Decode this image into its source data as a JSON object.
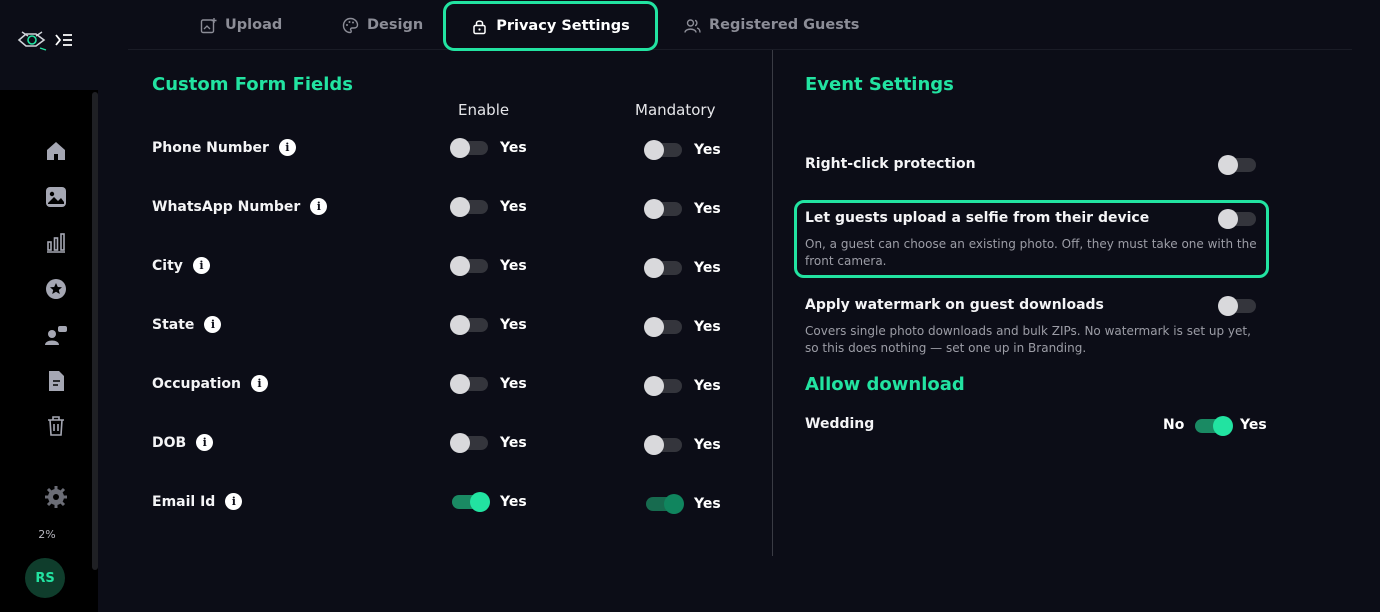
{
  "sidebar": {
    "storage": "2%",
    "avatar": "RS",
    "icons": [
      "home-icon",
      "gallery-icon",
      "analytics-icon",
      "star-icon",
      "users-icon",
      "document-icon",
      "trash-icon",
      "settings-icon"
    ]
  },
  "tabs": [
    {
      "label": "Upload",
      "icon": "upload-icon",
      "active": false
    },
    {
      "label": "Design",
      "icon": "palette-icon",
      "active": false
    },
    {
      "label": "Privacy Settings",
      "icon": "lock-icon",
      "active": true
    },
    {
      "label": "Registered Guests",
      "icon": "guests-icon",
      "active": false
    }
  ],
  "custom_fields": {
    "title": "Custom Form Fields",
    "enable_header": "Enable",
    "mandatory_header": "Mandatory",
    "rows": [
      {
        "label": "Phone Number",
        "enable": false,
        "mandatory": false,
        "enable_text": "Yes",
        "mandatory_text": "Yes"
      },
      {
        "label": "WhatsApp Number",
        "enable": false,
        "mandatory": false,
        "enable_text": "Yes",
        "mandatory_text": "Yes"
      },
      {
        "label": "City",
        "enable": false,
        "mandatory": false,
        "enable_text": "Yes",
        "mandatory_text": "Yes"
      },
      {
        "label": "State",
        "enable": false,
        "mandatory": false,
        "enable_text": "Yes",
        "mandatory_text": "Yes"
      },
      {
        "label": "Occupation",
        "enable": false,
        "mandatory": false,
        "enable_text": "Yes",
        "mandatory_text": "Yes"
      },
      {
        "label": "DOB",
        "enable": false,
        "mandatory": false,
        "enable_text": "Yes",
        "mandatory_text": "Yes"
      },
      {
        "label": "Email Id",
        "enable": true,
        "mandatory": true,
        "enable_text": "Yes",
        "mandatory_text": "Yes"
      }
    ]
  },
  "event_settings": {
    "title": "Event Settings",
    "right_click": {
      "label": "Right-click protection",
      "on": false
    },
    "selfie_upload": {
      "label": "Let guests upload a selfie from their device",
      "description": "On, a guest can choose an existing photo. Off, they must take one with the front camera.",
      "on": false
    },
    "watermark": {
      "label": "Apply watermark on guest downloads",
      "description": "Covers single photo downloads and bulk ZIPs. No watermark is set up yet, so this does nothing — set one up in Branding.",
      "on": false
    }
  },
  "allow_download": {
    "title": "Allow download",
    "row_label": "Wedding",
    "no_label": "No",
    "yes_label": "Yes",
    "on": true
  },
  "colors": {
    "accent": "#22e3a1",
    "background": "#0c0d17",
    "sidebar": "#000000"
  }
}
